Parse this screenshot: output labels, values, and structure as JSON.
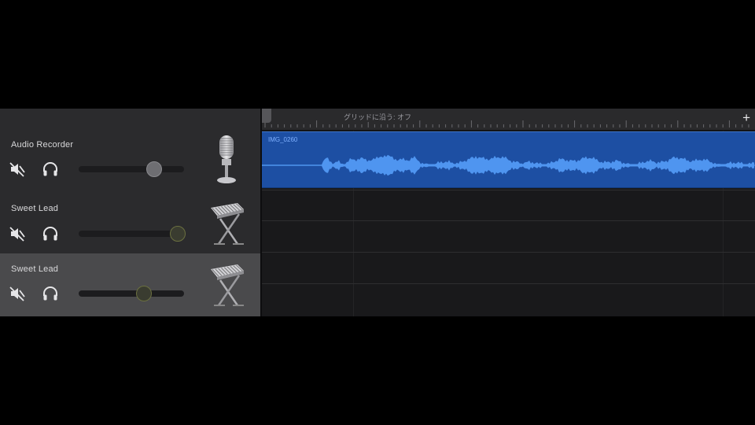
{
  "tracks": [
    {
      "name": "Audio Recorder",
      "volume_fraction": 0.72,
      "knob_color": "#6e6e72",
      "knob_border": "#8a8a8e",
      "instrument_icon": "microphone-icon",
      "selected": false
    },
    {
      "name": "Sweet Lead",
      "volume_fraction": 0.94,
      "knob_color": "#3a3c30",
      "knob_border": "#6b7040",
      "instrument_icon": "keyboard-stand-icon",
      "selected": false
    },
    {
      "name": "Sweet Lead",
      "volume_fraction": 0.62,
      "knob_color": "#3a3c30",
      "knob_border": "#6b7040",
      "instrument_icon": "keyboard-stand-icon",
      "selected": true
    }
  ],
  "ruler": {
    "snap_label": "グリッドに沿う: オフ",
    "add_icon": "plus-icon",
    "add_label": "+"
  },
  "region": {
    "name": "IMG_0260",
    "color": "#1d4fa3",
    "waveform_color": "#4f95f0"
  },
  "colors": {
    "selected_track": "#4a4a4c",
    "track_header": "#2b2b2d"
  }
}
